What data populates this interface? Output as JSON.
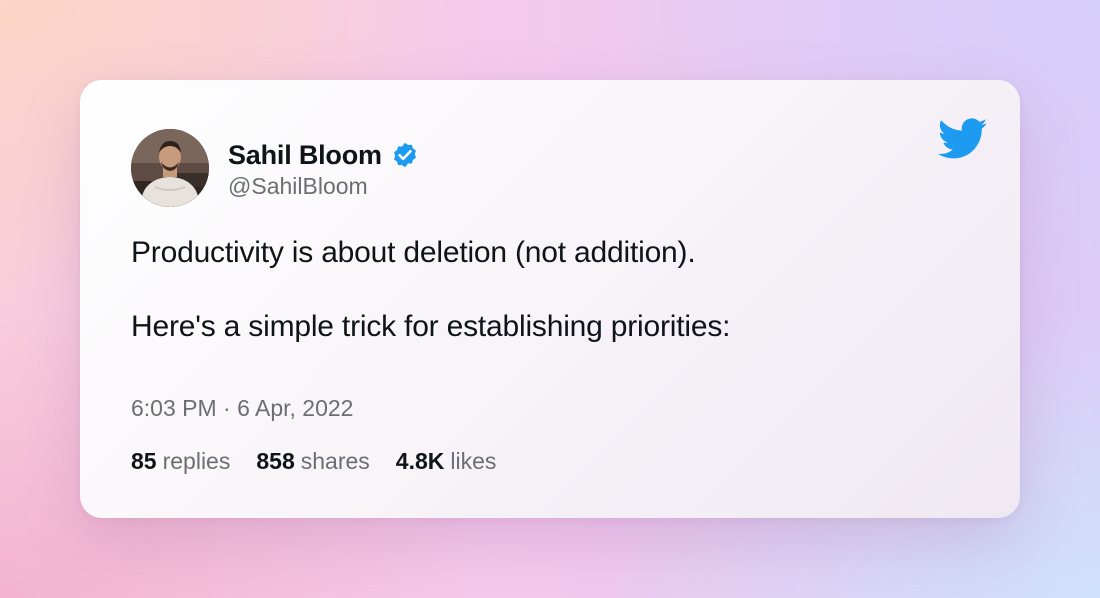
{
  "author": {
    "name": "Sahil Bloom",
    "handle": "@SahilBloom",
    "verified": true,
    "avatar": "avatar-photo"
  },
  "tweet": {
    "lines": [
      "Productivity is about deletion (not addition).",
      "Here's a simple trick for establishing priorities:"
    ],
    "timestamp": "6:03 PM · 6 Apr, 2022"
  },
  "stats": [
    {
      "count": "85",
      "label": "replies"
    },
    {
      "count": "858",
      "label": "shares"
    },
    {
      "count": "4.8K",
      "label": "likes"
    }
  ],
  "icons": {
    "brand": "twitter-bird-icon",
    "verified": "verified-badge-icon"
  },
  "colors": {
    "twitter_blue": "#1d9bf0",
    "text_primary": "#0f1419",
    "text_secondary": "#6b6f73"
  }
}
